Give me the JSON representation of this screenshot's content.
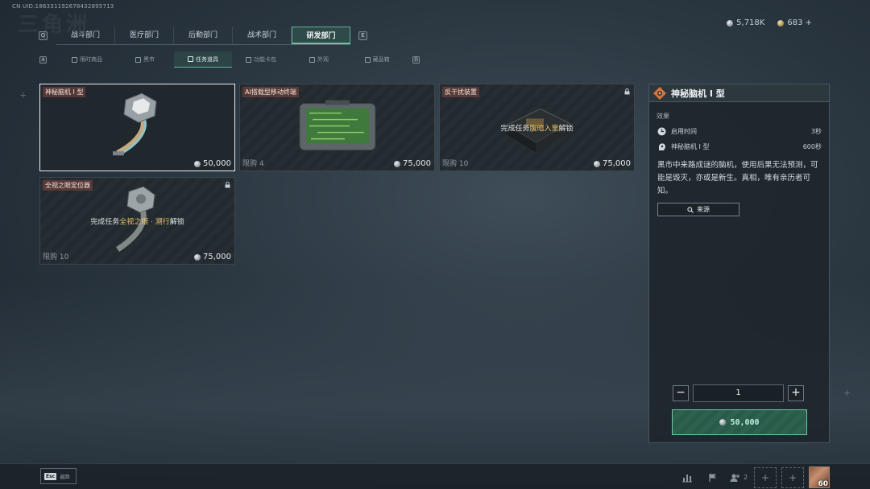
{
  "header": {
    "uid": "CN UID:18633119267843289571​3",
    "currency_silver": "5,718K",
    "currency_gold": "683 +"
  },
  "departments": {
    "left_key": "Q",
    "right_key": "E",
    "tabs": [
      {
        "label": "战斗部门",
        "active": false
      },
      {
        "label": "医疗部门",
        "active": false
      },
      {
        "label": "后勤部门",
        "active": false
      },
      {
        "label": "战术部门",
        "active": false
      },
      {
        "label": "研发部门",
        "active": true
      }
    ]
  },
  "subtabs": {
    "left_key": "A",
    "right_key": "D",
    "tabs": [
      {
        "label": "限时商品",
        "icon": "dna-icon",
        "active": false
      },
      {
        "label": "黑市",
        "icon": "market-icon",
        "active": false
      },
      {
        "label": "任务道具",
        "icon": "document-icon",
        "active": true
      },
      {
        "label": "功能卡包",
        "icon": "card-icon",
        "active": false
      },
      {
        "label": "外观",
        "icon": "shirt-icon",
        "active": false
      },
      {
        "label": "藏品箱",
        "icon": "box-icon",
        "active": false
      }
    ]
  },
  "items": [
    {
      "name": "神秘脑机 I 型",
      "limit": "",
      "price": "50,000",
      "locked": false,
      "selected": true,
      "lock_msg": null
    },
    {
      "name": "AI搭载型移动终端",
      "limit": "限购 4",
      "price": "75,000",
      "locked": false,
      "selected": false,
      "lock_msg": null
    },
    {
      "name": "反干扰装置",
      "limit": "限购 10",
      "price": "75,000",
      "locked": true,
      "selected": false,
      "lock_msg": {
        "pre": "完成任务",
        "hl": "腹暗入里",
        "post": "解锁"
      }
    },
    {
      "name": "全视之眼定位器",
      "limit": "限购 10",
      "price": "75,000",
      "locked": true,
      "selected": false,
      "lock_msg": {
        "pre": "完成任务",
        "hl": "全视之眼 · 溯行",
        "post": "解锁"
      }
    }
  ],
  "detail": {
    "title": "神秘脑机 I 型",
    "effect_label": "效果",
    "effects": [
      {
        "icon": "clock-icon",
        "label": "启用时间",
        "value": "3秒"
      },
      {
        "icon": "head-icon",
        "label": "神秘脑机 I 型",
        "value": "600秒"
      }
    ],
    "description": "黑市中来路成谜的脑机，使用后果无法预测，可能是毁灭，亦或是新生。真相，唯有亲历者可知。",
    "source_label": "来源",
    "quantity": "1",
    "buy_price": "50,000"
  },
  "footer": {
    "esc_key": "Esc",
    "esc_label": "返回",
    "friends_count": "2",
    "level": "60"
  }
}
